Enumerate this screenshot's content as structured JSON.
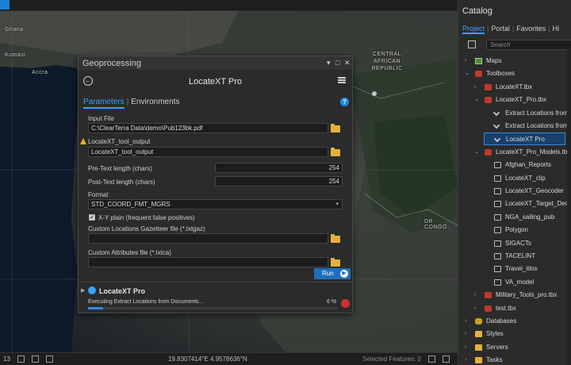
{
  "map": {
    "labels": {
      "ghana": "Ghana",
      "kumasi": "Kumasi",
      "accra": "Accra",
      "car_line1": "CENTRAL",
      "car_line2": "AFRICAN",
      "car_line3": "REPUBLIC",
      "drc": "DR CONGO"
    }
  },
  "statusbar": {
    "scale": "13",
    "coordinates": "19.8307414°E 4.9578636°N",
    "selected_features": "Selected Features: 0"
  },
  "geoprocessing": {
    "window_title": "Geoprocessing",
    "tool_name": "LocateXT Pro",
    "tabs": {
      "parameters": "Parameters",
      "environments": "Environments"
    },
    "input_file": {
      "label": "Input File",
      "value": "C:\\ClearTerra Data\\demo\\Pub123bk.pdf"
    },
    "output": {
      "label": "LocateXT_tool_output",
      "value": "LocateXT_tool_output"
    },
    "pre_text": {
      "label": "Pre-Text length (chars)",
      "value": "254"
    },
    "post_text": {
      "label": "Post-Text length (chars)",
      "value": "254"
    },
    "format": {
      "label": "Format",
      "value": "STD_COORD_FMT_MGRS"
    },
    "xy_plain": {
      "label": "X-Y plain (frequent false positives)",
      "checked": true
    },
    "gazetteer": {
      "label": "Custom Locations Gazetteer file (*.lxtgaz)",
      "value": ""
    },
    "attributes": {
      "label": "Custom Attributes file (*.lxtca)",
      "value": ""
    },
    "run_label": "Run",
    "job": {
      "title": "LocateXT Pro",
      "status": "Executing Extract Locations from Documents...",
      "percent_text": "6 %",
      "progress": 0.06
    }
  },
  "catalog": {
    "title": "Catalog",
    "tabs": [
      "Project",
      "Portal",
      "Favorites",
      "Hi"
    ],
    "search_placeholder": "Search",
    "tree": [
      {
        "label": "Maps",
        "indent": 0,
        "icon": "map-icon",
        "chev": "›"
      },
      {
        "label": "Toolboxes",
        "indent": 0,
        "icon": "toolbox-icon",
        "chev": "⌄"
      },
      {
        "label": "LocateXT.tbx",
        "indent": 1,
        "icon": "toolbox-icon",
        "chev": "›"
      },
      {
        "label": "LocateXT_Pro.tbx",
        "indent": 1,
        "icon": "toolbox-icon",
        "chev": "⌄"
      },
      {
        "label": "Extract Locations from",
        "indent": 2,
        "icon": "script-tool-icon",
        "chev": ""
      },
      {
        "label": "Extract Locations from",
        "indent": 2,
        "icon": "script-tool-icon",
        "chev": ""
      },
      {
        "label": "LocateXT Pro",
        "indent": 2,
        "icon": "script-tool-icon",
        "chev": "",
        "selected": true
      },
      {
        "label": "LocateXT_Pro_Models.tbx",
        "indent": 1,
        "icon": "toolbox-icon",
        "chev": "⌄"
      },
      {
        "label": "Afghan_Reports",
        "indent": 2,
        "icon": "model-icon",
        "chev": ""
      },
      {
        "label": "LocateXT_clip",
        "indent": 2,
        "icon": "model-icon",
        "chev": ""
      },
      {
        "label": "LocateXT_Geocoder",
        "indent": 2,
        "icon": "model-icon",
        "chev": ""
      },
      {
        "label": "LocateXT_Target_Deck",
        "indent": 2,
        "icon": "model-icon",
        "chev": ""
      },
      {
        "label": "NGA_sailing_pub",
        "indent": 2,
        "icon": "model-icon",
        "chev": ""
      },
      {
        "label": "Polygon",
        "indent": 2,
        "icon": "model-icon",
        "chev": ""
      },
      {
        "label": "SIGACTs",
        "indent": 2,
        "icon": "model-icon",
        "chev": ""
      },
      {
        "label": "TACELINT",
        "indent": 2,
        "icon": "model-icon",
        "chev": ""
      },
      {
        "label": "Travel_itins",
        "indent": 2,
        "icon": "model-icon",
        "chev": ""
      },
      {
        "label": "VA_model",
        "indent": 2,
        "icon": "model-icon",
        "chev": ""
      },
      {
        "label": "Military_Tools_pro.tbx",
        "indent": 1,
        "icon": "toolbox-icon",
        "chev": "›"
      },
      {
        "label": "test.tbx",
        "indent": 1,
        "icon": "toolbox-icon",
        "chev": "›"
      },
      {
        "label": "Databases",
        "indent": 0,
        "icon": "database-icon",
        "chev": "›"
      },
      {
        "label": "Styles",
        "indent": 0,
        "icon": "folder-icon",
        "chev": "›"
      },
      {
        "label": "Servers",
        "indent": 0,
        "icon": "folder-icon",
        "chev": "›"
      },
      {
        "label": "Tasks",
        "indent": 0,
        "icon": "folder-icon",
        "chev": "›"
      }
    ]
  },
  "colors": {
    "accent": "#3aa0ff",
    "run_button": "#1e6fbf",
    "warning": "#f2b01e",
    "cancel": "#d13030"
  }
}
